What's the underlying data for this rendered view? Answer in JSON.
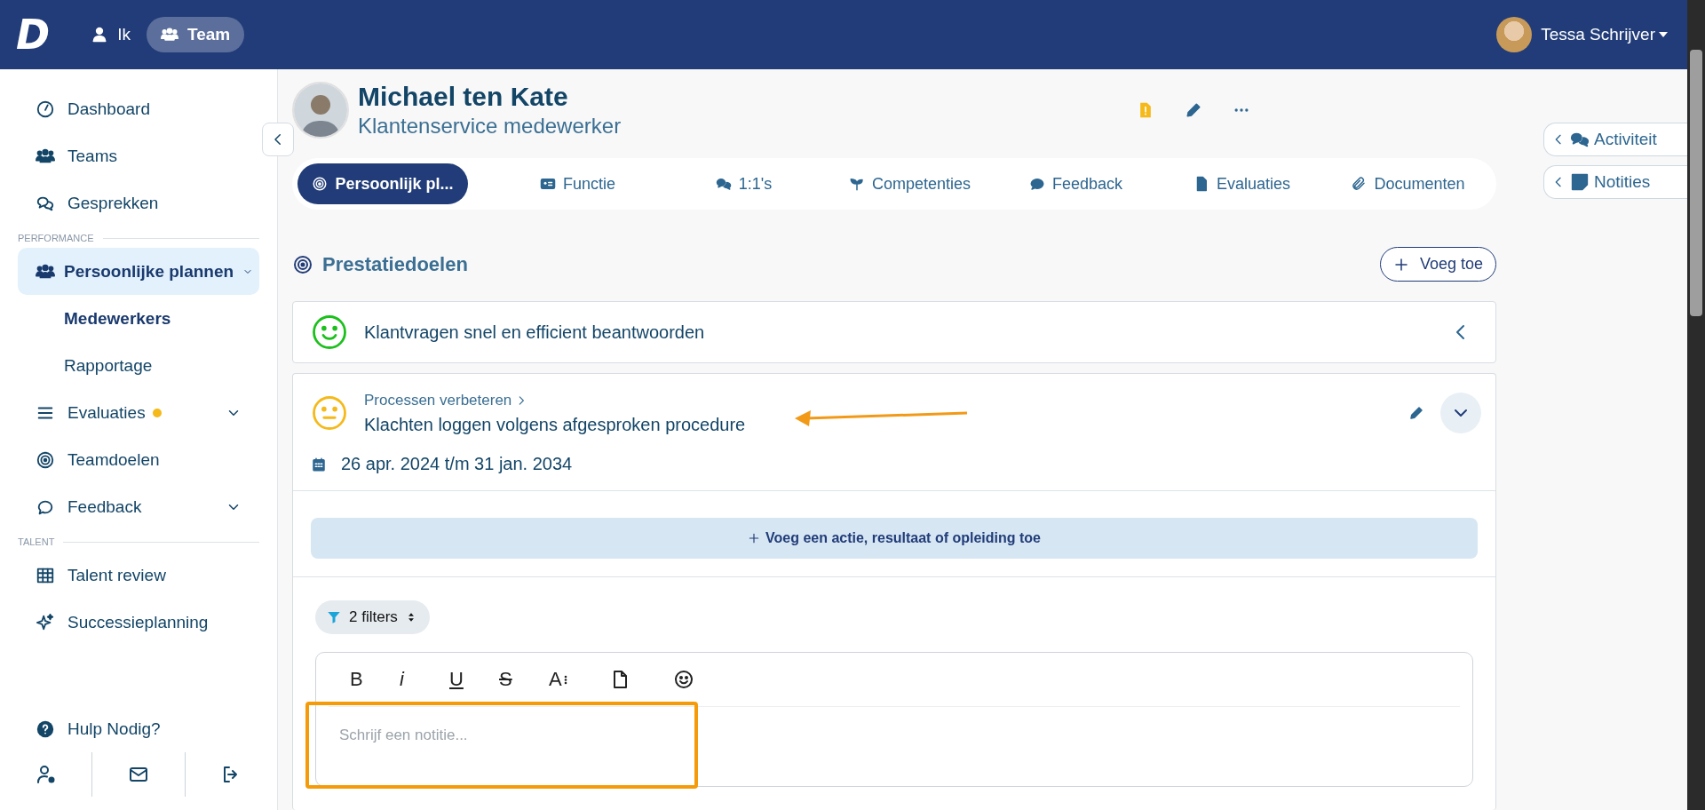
{
  "topbar": {
    "logo": "D",
    "modes": [
      {
        "label": "Ik",
        "selected": false
      },
      {
        "label": "Team",
        "selected": true
      }
    ],
    "user": {
      "name": "Tessa Schrijver"
    }
  },
  "sidebar": {
    "items": [
      {
        "kind": "item",
        "label": "Dashboard",
        "selected": false
      },
      {
        "kind": "item",
        "label": "Teams",
        "selected": false
      },
      {
        "kind": "item",
        "label": "Gesprekken",
        "selected": false
      },
      {
        "kind": "section",
        "label": "PERFORMANCE"
      },
      {
        "kind": "item",
        "label": "Persoonlijke plannen",
        "selected": true,
        "expanded": true
      },
      {
        "kind": "subitem",
        "label": "Medewerkers",
        "selected": true
      },
      {
        "kind": "subitem",
        "label": "Rapportage",
        "selected": false
      },
      {
        "kind": "item",
        "label": "Evaluaties",
        "selected": false,
        "expanded": false,
        "dot": true
      },
      {
        "kind": "item",
        "label": "Teamdoelen",
        "selected": false
      },
      {
        "kind": "item",
        "label": "Feedback",
        "selected": false,
        "expanded": false
      },
      {
        "kind": "section",
        "label": "TALENT"
      },
      {
        "kind": "item",
        "label": "Talent review",
        "selected": false
      },
      {
        "kind": "item",
        "label": "Successieplanning",
        "selected": false
      }
    ],
    "help": "Hulp Nodig?"
  },
  "profile": {
    "name": "Michael ten Kate",
    "role": "Klantenservice medewerker"
  },
  "tabs": [
    {
      "label": "Persoonlijk pl...",
      "selected": true
    },
    {
      "label": "Functie",
      "selected": false
    },
    {
      "label": "1:1's",
      "selected": false
    },
    {
      "label": "Competenties",
      "selected": false
    },
    {
      "label": "Feedback",
      "selected": false
    },
    {
      "label": "Evaluaties",
      "selected": false
    },
    {
      "label": "Documenten",
      "selected": false
    }
  ],
  "section": {
    "title": "Prestatiedoelen",
    "add_button": "Voeg toe"
  },
  "goals": [
    {
      "kind": "happy",
      "color": "#1cc01c",
      "title": "Klantvragen snel en efficient beantwoorden",
      "expanded": false
    },
    {
      "kind": "neutral",
      "color": "#f5b919",
      "parent": "Processen verbeteren",
      "title": "Klachten loggen volgens afgesproken procedure",
      "expanded": true,
      "dates": "26 apr. 2024 t/m 31 jan. 2034",
      "add_action": "Voeg een actie, resultaat of opleiding toe",
      "filters": "2 filters",
      "toolbar": [
        {
          "kind": "bold",
          "label": "B"
        },
        {
          "kind": "italic",
          "label": "i"
        },
        {
          "kind": "underline",
          "label": "U"
        },
        {
          "kind": "strike",
          "label": "S"
        },
        {
          "kind": "size",
          "label": "A"
        },
        {
          "kind": "file"
        },
        {
          "kind": "emoji"
        }
      ],
      "note": {
        "placeholder": "Schrijf een notitie..."
      }
    }
  ],
  "side_panels": [
    {
      "label": "Activiteit"
    },
    {
      "label": "Notities"
    }
  ]
}
